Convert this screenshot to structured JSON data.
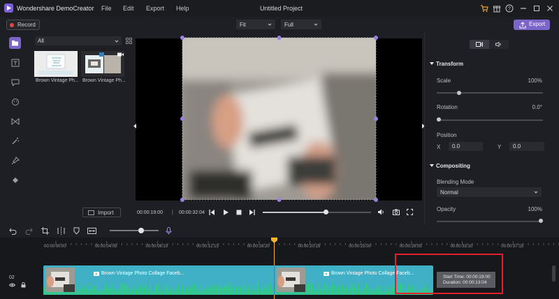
{
  "app": {
    "name": "Wondershare DemoCreator",
    "project_title": "Untitled Project"
  },
  "menu": [
    "File",
    "Edit",
    "Export",
    "Help"
  ],
  "toolbar": {
    "record_label": "Record",
    "fit_select": "Fit",
    "full_select": "Full",
    "export_label": "Export"
  },
  "library": {
    "filter": "All",
    "items": [
      {
        "caption": "Brown Vintage Ph...",
        "thumb_text": "VINTAGE PHOTO BOOK MOCKUP"
      },
      {
        "caption": "Brown Vintage Ph..."
      }
    ],
    "import_label": "Import"
  },
  "preview": {
    "current_time": "00:00:19:00",
    "total_time": "00:00:32:04",
    "progress": 0.59
  },
  "properties": {
    "transform_label": "Transform",
    "scale_label": "Scale",
    "scale_value": "100%",
    "rotation_label": "Rotation",
    "rotation_value": "0.0°",
    "position_label": "Position",
    "x_label": "X",
    "x_value": "0.0",
    "y_label": "Y",
    "y_value": "0.0",
    "compositing_label": "Compositing",
    "blending_label": "Blending Mode",
    "blending_value": "Normal",
    "opacity_label": "Opacity",
    "opacity_value": "100%"
  },
  "timeline": {
    "ticks": [
      "00:00:00:00",
      "00:00:04:05",
      "00:00:08:10",
      "00:00:12:15",
      "00:00:16:20",
      "00:00:20:25",
      "00:00:25:00",
      "00:00:29:05",
      "00:00:33:10",
      "00:00:37:15"
    ],
    "track_number": "02",
    "clip_title": "Brown Vintage Photo Collage Faceb...",
    "clip_title_2": "Brown Vintage Photo Collage Faceb...",
    "tooltip_start": "Start Time: 00:00:19:00",
    "tooltip_duration": "Duration: 00:00:13:04"
  },
  "colors": {
    "accent": "#7c65c8",
    "clip": "#3fb0c6",
    "waveform": "#2fd07a",
    "playhead": "#f2b531",
    "highlight": "#e0202a"
  }
}
